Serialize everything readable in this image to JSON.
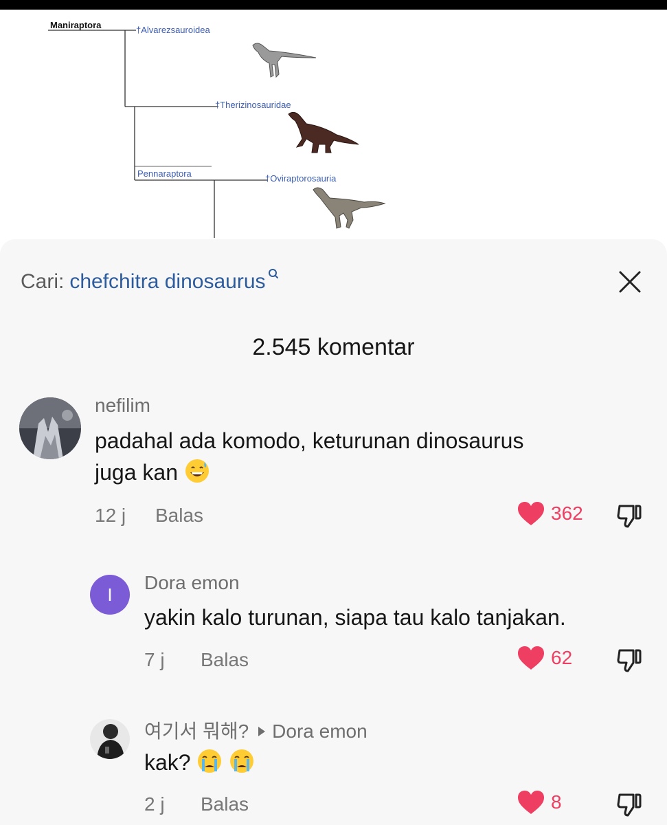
{
  "cladogram": {
    "root": "Maniraptora",
    "taxa": [
      "†Alvarezsauroidea",
      "†Therizinosauridae",
      "†Oviraptorosauria"
    ],
    "clade": "Pennaraptora"
  },
  "search": {
    "prefix": "Cari:",
    "query": "chefchitra dinosaurus"
  },
  "comments_count": "2.545 komentar",
  "reply_label": "Balas",
  "comments": [
    {
      "username": "nefilim",
      "text_line1": "padahal ada komodo, keturunan dinosaurus",
      "text_line2": "juga kan",
      "time": "12 j",
      "likes": "362"
    },
    {
      "username": "Dora emon",
      "avatar_letter": "I",
      "text": "yakin kalo turunan, siapa tau kalo tanjakan.",
      "time": "7 j",
      "likes": "62"
    },
    {
      "username": "여기서 뭐해?",
      "reply_to": "Dora emon",
      "text": "kak?",
      "time": "2 j",
      "likes": "8"
    }
  ],
  "colors": {
    "accent_blue": "#2d5c9e",
    "like_red": "#ee3e62",
    "avatar_purple": "#7b5bd6"
  }
}
